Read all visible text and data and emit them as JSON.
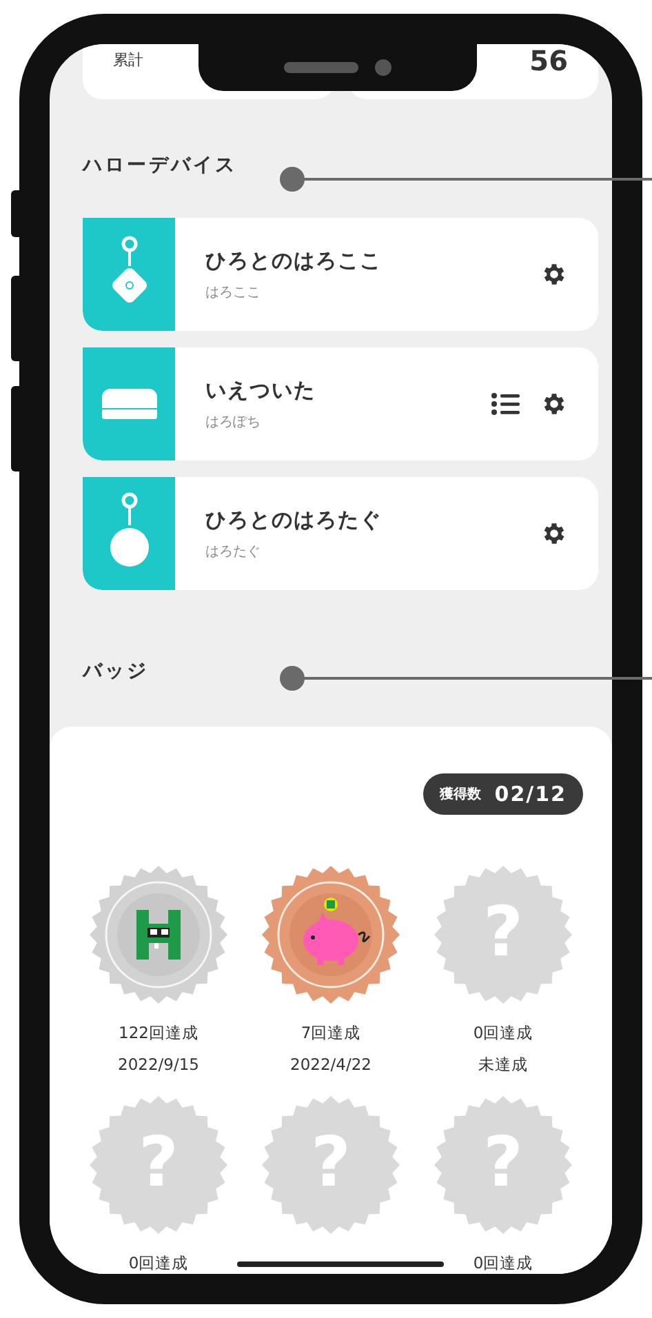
{
  "summary_cards": [
    {
      "label": "累計"
    },
    {
      "value": "56"
    }
  ],
  "devices_section": {
    "title": "ハローデバイス"
  },
  "devices": [
    {
      "name": "ひろとのはろここ",
      "model": "はろここ",
      "kind": "diamond-tag",
      "actions": [
        {
          "kind": "settings"
        }
      ]
    },
    {
      "name": "いえついた",
      "model": "はろぽち",
      "kind": "box",
      "actions": [
        {
          "kind": "list"
        },
        {
          "kind": "settings"
        }
      ]
    },
    {
      "name": "ひろとのはろたぐ",
      "model": "はろたぐ",
      "kind": "round-tag",
      "actions": [
        {
          "kind": "settings"
        }
      ]
    }
  ],
  "badges_section": {
    "title": "バッジ",
    "count_label": "獲得数",
    "count": "02/12"
  },
  "badges": [
    {
      "kind": "silver",
      "times": "122回達成",
      "date": "2022/9/15"
    },
    {
      "kind": "bronze",
      "times": "7回達成",
      "date": "2022/4/22"
    },
    {
      "kind": "locked",
      "symbol": "?",
      "times": "0回達成",
      "date": "未達成"
    },
    {
      "kind": "locked",
      "symbol": "?",
      "times": "0回達成"
    },
    {
      "kind": "locked",
      "symbol": "?"
    },
    {
      "kind": "locked",
      "symbol": "?",
      "times": "0回達成"
    }
  ]
}
